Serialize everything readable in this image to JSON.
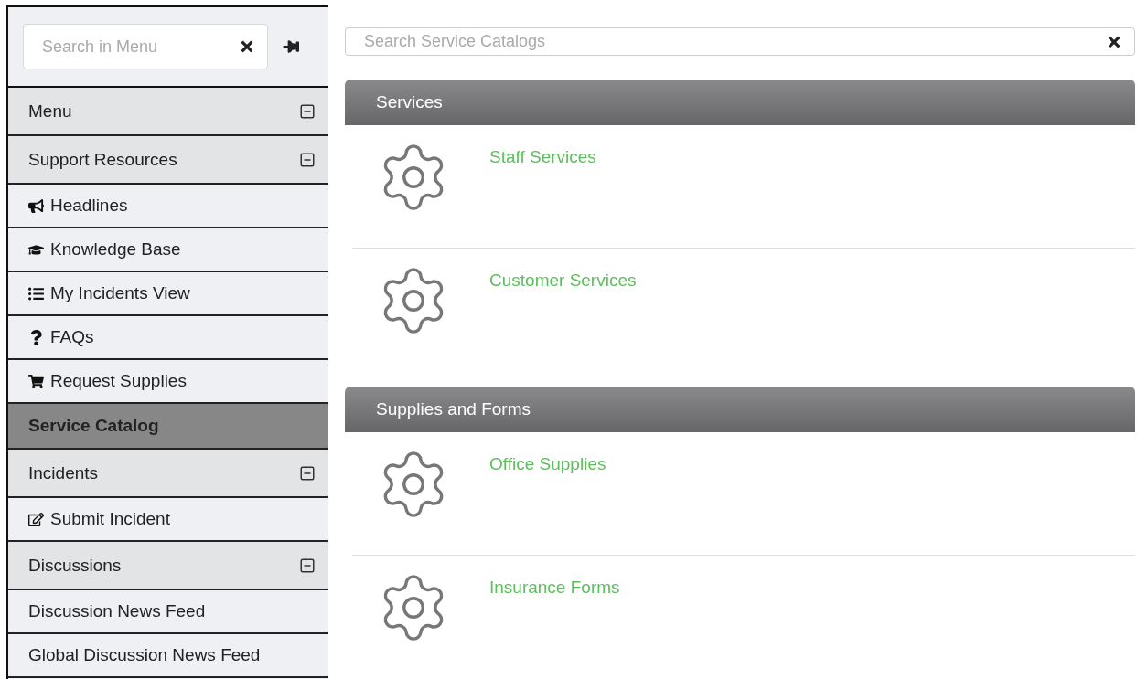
{
  "sidebar": {
    "search": {
      "placeholder": "Search in Menu"
    },
    "items": [
      {
        "kind": "header",
        "label": "Menu",
        "expanded": true
      },
      {
        "kind": "header",
        "label": "Support Resources",
        "expanded": true
      },
      {
        "kind": "link",
        "label": "Headlines"
      },
      {
        "kind": "link",
        "label": "Knowledge Base"
      },
      {
        "kind": "link",
        "label": "My Incidents View"
      },
      {
        "kind": "link",
        "label": "FAQs"
      },
      {
        "kind": "link",
        "label": "Request Supplies"
      },
      {
        "kind": "section",
        "label": "Service Catalog"
      },
      {
        "kind": "header",
        "label": "Incidents",
        "expanded": true
      },
      {
        "kind": "link",
        "label": "Submit Incident"
      },
      {
        "kind": "header",
        "label": "Discussions",
        "expanded": true
      },
      {
        "kind": "link",
        "label": "Discussion News Feed"
      },
      {
        "kind": "link",
        "label": "Global Discussion News Feed"
      }
    ]
  },
  "main": {
    "search": {
      "placeholder": "Search Service Catalogs"
    },
    "groups": [
      {
        "title": "Services",
        "items": [
          {
            "label": "Staff Services"
          },
          {
            "label": "Customer Services"
          }
        ]
      },
      {
        "title": "Supplies and Forms",
        "items": [
          {
            "label": "Office Supplies"
          },
          {
            "label": "Insurance Forms"
          }
        ]
      }
    ]
  }
}
